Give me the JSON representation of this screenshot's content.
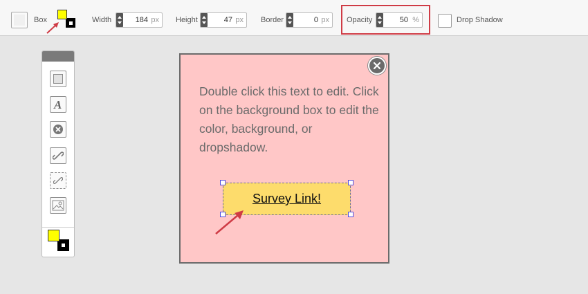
{
  "toolbar": {
    "box_label": "Box",
    "width_label": "Width",
    "width_value": "184",
    "width_unit": "px",
    "height_label": "Height",
    "height_value": "47",
    "height_unit": "px",
    "border_label": "Border",
    "border_value": "0",
    "border_unit": "px",
    "opacity_label": "Opacity",
    "opacity_value": "50",
    "opacity_unit": "%",
    "drop_shadow_label": "Drop Shadow",
    "foreground_color": "#ffff00",
    "background_color": "#000000"
  },
  "toolbox": {
    "tools": [
      "box-tool-icon",
      "text-tool-icon",
      "close-tool-icon",
      "link-tool-icon",
      "dashed-link-tool-icon",
      "image-tool-icon"
    ],
    "color_swatch_fg": "#ffff00",
    "color_swatch_bg": "#000000"
  },
  "canvas": {
    "text": "Double click this text to edit. Click on the background box to edit the color, background, or dropshadow.",
    "link_label": "Survey Link!",
    "card_color": "#ffc7c7",
    "link_color": "#fddc6c"
  },
  "annotations": {
    "highlight_color": "#cf3b45",
    "arrow_color": "#cf3b45"
  }
}
